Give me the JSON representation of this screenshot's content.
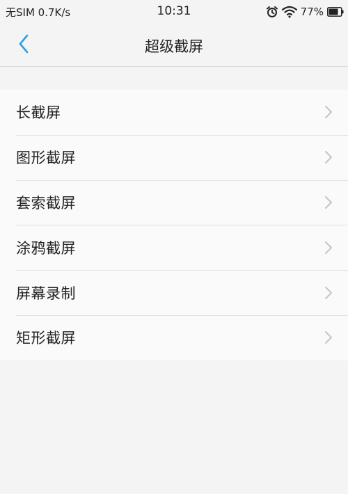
{
  "status_bar": {
    "carrier": "无SIM 0.7K/s",
    "time": "10:31",
    "battery_percent": "77%",
    "icons": [
      "alarm-icon",
      "wifi-icon",
      "battery-icon"
    ]
  },
  "nav": {
    "title": "超级截屏",
    "back_icon": "chevron-left-icon",
    "accent_color": "#2b9fe0"
  },
  "items": [
    {
      "label": "长截屏"
    },
    {
      "label": "图形截屏"
    },
    {
      "label": "套索截屏"
    },
    {
      "label": "涂鸦截屏"
    },
    {
      "label": "屏幕录制"
    },
    {
      "label": "矩形截屏"
    }
  ]
}
